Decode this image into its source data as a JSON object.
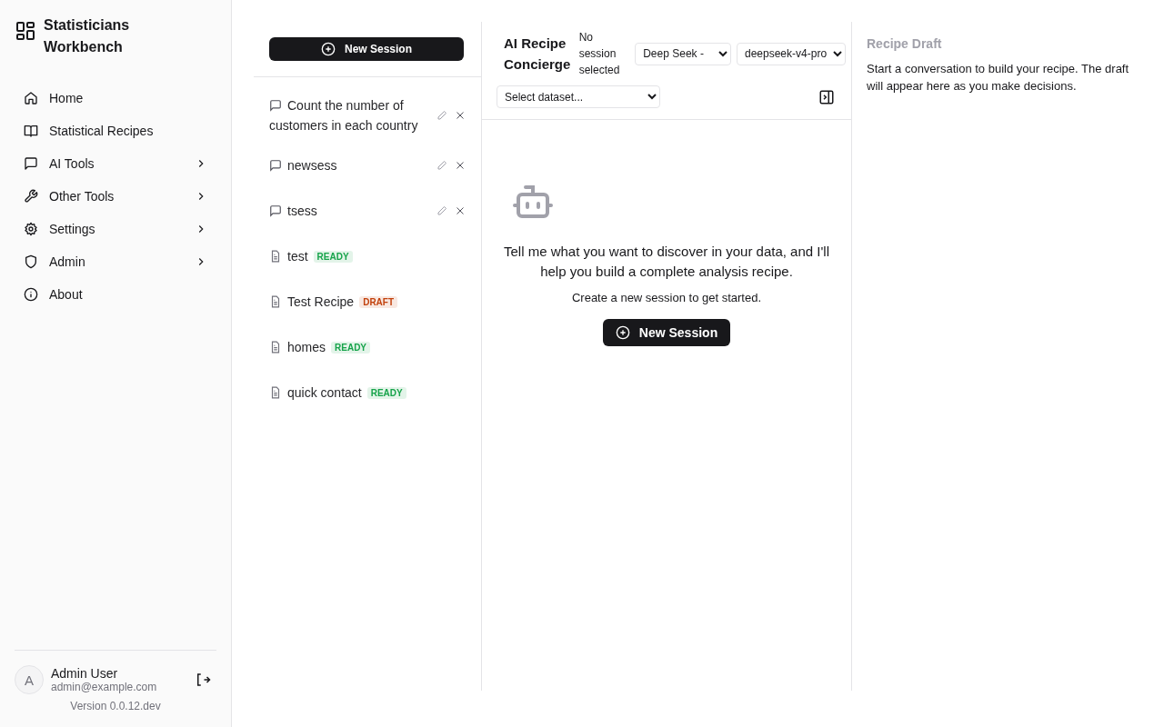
{
  "app": {
    "title": "Statisticians Workbench"
  },
  "nav": [
    {
      "label": "Home",
      "has_submenu": false
    },
    {
      "label": "Statistical Recipes",
      "has_submenu": false
    },
    {
      "label": "AI Tools",
      "has_submenu": true
    },
    {
      "label": "Other Tools",
      "has_submenu": true
    },
    {
      "label": "Settings",
      "has_submenu": true
    },
    {
      "label": "Admin",
      "has_submenu": true
    },
    {
      "label": "About",
      "has_submenu": false
    }
  ],
  "user": {
    "initial": "A",
    "name": "Admin User",
    "email": "admin@example.com"
  },
  "version": "Version 0.0.12.dev",
  "sessions_panel": {
    "new_button": "New Session",
    "items": [
      {
        "kind": "session",
        "title": "Count the number of customers in each country"
      },
      {
        "kind": "session",
        "title": "newsess"
      },
      {
        "kind": "session",
        "title": "tsess"
      },
      {
        "kind": "recipe",
        "title": "test",
        "badge": "READY",
        "color": "#16a34a"
      },
      {
        "kind": "recipe",
        "title": "Test Recipe",
        "badge": "DRAFT",
        "color": "#c2410c"
      },
      {
        "kind": "recipe",
        "title": "homes",
        "badge": "READY",
        "color": "#16a34a"
      },
      {
        "kind": "recipe",
        "title": "quick contact",
        "badge": "READY",
        "color": "#16a34a"
      }
    ]
  },
  "chat": {
    "title": "AI Recipe Concierge",
    "status": "No session selected",
    "provider": "Deep Seek -",
    "model": "deepseek-v4-pro",
    "dataset_placeholder": "Select dataset...",
    "empty_message": "Tell me what you want to discover in your data, and I'll help you build a complete analysis recipe.",
    "hint": "Create a new session to get started.",
    "new_button": "New Session"
  },
  "draft": {
    "title": "Recipe Draft",
    "text": "Start a conversation to build your recipe. The draft will appear here as you make decisions."
  }
}
